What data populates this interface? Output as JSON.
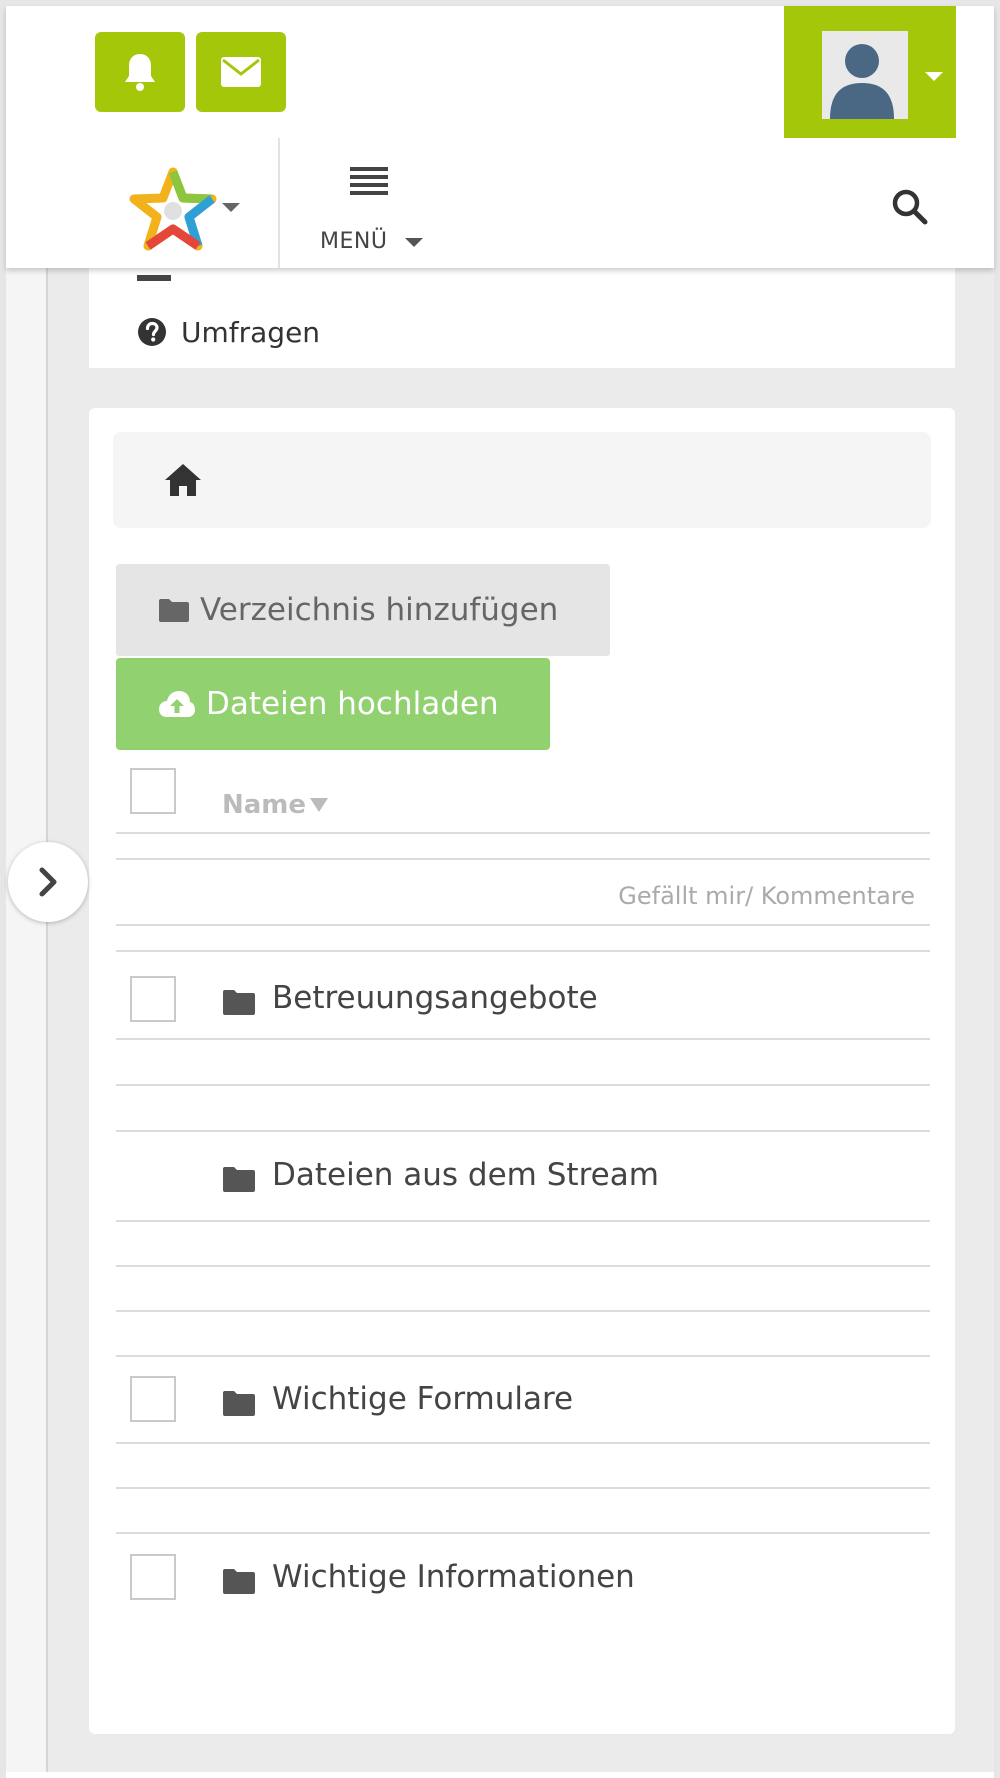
{
  "header": {
    "notifications_icon": "bell-icon",
    "messages_icon": "envelope-icon",
    "menu_label": "MENÜ",
    "accent_color": "#a5c70a"
  },
  "sidebar_card": {
    "items": [
      {
        "label": "Umfragen",
        "icon": "question-circle-icon"
      }
    ]
  },
  "files": {
    "add_directory_label": "Verzeichnis hinzufügen",
    "upload_label": "Dateien hochladen",
    "column_name": "Name",
    "column_likes": "Gefällt mir/ Kommentare",
    "rows": [
      {
        "name": "Betreuungsangebote",
        "has_checkbox": true
      },
      {
        "name": "Dateien aus dem Stream",
        "has_checkbox": false
      },
      {
        "name": "Wichtige Formulare",
        "has_checkbox": true
      },
      {
        "name": "Wichtige Informationen",
        "has_checkbox": true
      }
    ],
    "upload_color": "#92d16f"
  }
}
